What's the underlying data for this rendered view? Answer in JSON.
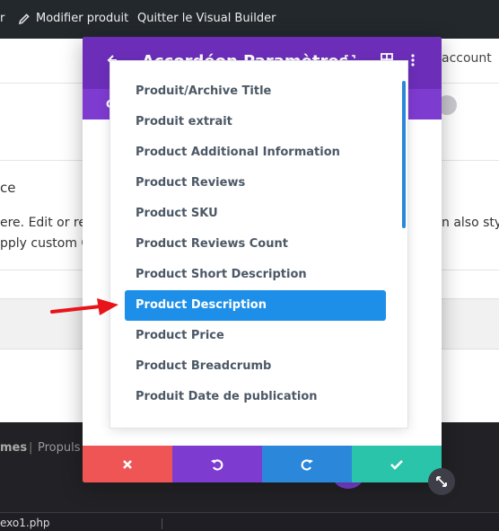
{
  "adminbar": {
    "cut_text": "r",
    "edit_label": "Modifier produit",
    "quit_label": "Quitter le Visual Builder"
  },
  "page": {
    "account": "account",
    "text_ce": "ce",
    "text_ere": "ere. Edit or ren",
    "text_pply": "pply custom CS",
    "text_also": "n also styl"
  },
  "footer": {
    "mes": "mes",
    "sep": "|",
    "prop": "Propuls"
  },
  "bottombar": {
    "filename": "exo1.php"
  },
  "modal": {
    "title": "Accordéon Paramètres",
    "tab_label": "C",
    "footer_icons": [
      "cancel-icon",
      "undo-icon",
      "redo-icon",
      "check-icon"
    ]
  },
  "dropdown": {
    "items": [
      {
        "label": "Produit/Archive Title"
      },
      {
        "label": "Produit extrait"
      },
      {
        "label": "Product Additional Information"
      },
      {
        "label": "Product Reviews"
      },
      {
        "label": "Product SKU"
      },
      {
        "label": "Product Reviews Count"
      },
      {
        "label": "Product Short Description"
      },
      {
        "label": "Product Description",
        "selected": true
      },
      {
        "label": "Product Price"
      },
      {
        "label": "Product Breadcrumb"
      },
      {
        "label": "Produit Date de publication"
      }
    ]
  },
  "colors": {
    "modal_header": "#6c2eb9",
    "modal_tabs": "#7e3bd0",
    "selected_item": "#1e8fe8",
    "cancel": "#ef5555",
    "undo": "#7e3bd0",
    "redo": "#2b87da",
    "save": "#29c4a9",
    "annotation_arrow": "#e8141a"
  }
}
